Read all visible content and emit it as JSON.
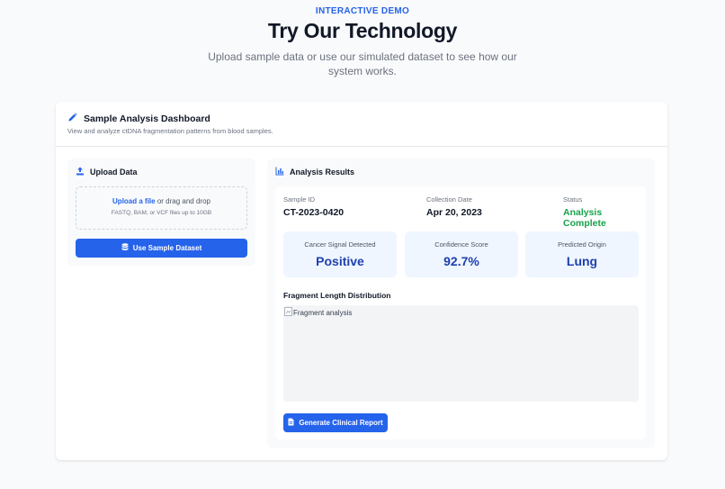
{
  "hero": {
    "eyebrow": "INTERACTIVE DEMO",
    "title": "Try Our Technology",
    "subtitle": "Upload sample data or use our simulated dataset to see how our system works."
  },
  "dashboard": {
    "title": "Sample Analysis Dashboard",
    "description": "View and analyze ctDNA fragmentation patterns from blood samples."
  },
  "upload": {
    "title": "Upload Data",
    "upload_link": "Upload a file",
    "drag_text": " or drag and drop",
    "hint": "FASTQ, BAM, or VCF files up to 10GB",
    "sample_button": "Use Sample Dataset"
  },
  "results": {
    "title": "Analysis Results",
    "sample_id_label": "Sample ID",
    "sample_id": "CT-2023-0420",
    "collection_date_label": "Collection Date",
    "collection_date": "Apr 20, 2023",
    "status_label": "Status",
    "status": "Analysis Complete",
    "stats": [
      {
        "label": "Cancer Signal Detected",
        "value": "Positive"
      },
      {
        "label": "Confidence Score",
        "value": "92.7%"
      },
      {
        "label": "Predicted Origin",
        "value": "Lung"
      }
    ],
    "chart_title": "Fragment Length Distribution",
    "chart_image_alt": "Fragment analysis",
    "report_button": "Generate Clinical Report"
  },
  "colors": {
    "accent": "#2563eb",
    "status_success": "#16a34a",
    "stat_value": "#1e40af",
    "stat_background": "#eff6ff"
  },
  "icons": {
    "dashboard": "pencil-icon",
    "upload": "upload-icon",
    "sample_button": "database-icon",
    "results": "bar-chart-icon",
    "report_button": "document-icon"
  }
}
